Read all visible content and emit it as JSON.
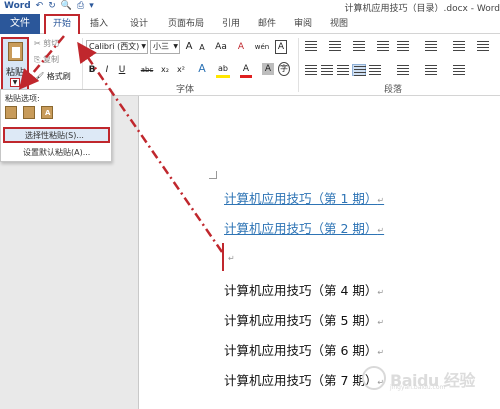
{
  "window": {
    "title": "计算机应用技巧（目录）.docx - Word",
    "qat": [
      "Word",
      "↶",
      "↻",
      "🔍",
      "⎙",
      "▾"
    ]
  },
  "ribbon_tabs": {
    "file": "文件",
    "tabs": [
      "开始",
      "插入",
      "设计",
      "页面布局",
      "引用",
      "邮件",
      "审阅",
      "视图"
    ]
  },
  "clipboard": {
    "paste_label": "粘贴",
    "cut": "✂ 剪切",
    "copy": "⎘ 复制",
    "format_painter": "🖌 格式刷"
  },
  "font": {
    "name": "Calibri (西文)",
    "size": "小三",
    "grow": "A",
    "shrink": "A",
    "case": "Aa",
    "clear": "A",
    "phonetic": "wén",
    "charborder": "A",
    "bold": "B",
    "italic": "I",
    "underline": "U",
    "strike": "abc",
    "sub": "x₂",
    "sup": "x²",
    "effects": "A",
    "highlight": "ab",
    "color": "A",
    "shade": "A",
    "circle": "字",
    "group_label": "字体"
  },
  "paragraph": {
    "group_label": "段落"
  },
  "paste_menu": {
    "header": "粘贴选项:",
    "icon_letters": [
      "",
      "",
      "A"
    ],
    "items": [
      "选择性粘贴(S)...",
      "设置默认粘贴(A)..."
    ]
  },
  "document": {
    "lines": [
      {
        "text": "计算机应用技巧（第 1 期）",
        "mark": "↵"
      },
      {
        "text": "计算机应用技巧（第 2 期）",
        "mark": "↵"
      },
      {
        "text": "计算机应用技巧（第 4 期）",
        "mark": "↵"
      },
      {
        "text": "计算机应用技巧（第 5 期）",
        "mark": "↵"
      },
      {
        "text": "计算机应用技巧（第 6 期）",
        "mark": "↵"
      },
      {
        "text": "计算机应用技巧（第 7 期）",
        "mark": "↵"
      }
    ],
    "empty_mark": "↵"
  },
  "watermark": {
    "main": "Baidu 经验",
    "sub": "jingyan.baidu.com"
  },
  "colors": {
    "accent": "#2b579a",
    "annotation": "#c0272d",
    "link": "#2e74b5"
  }
}
